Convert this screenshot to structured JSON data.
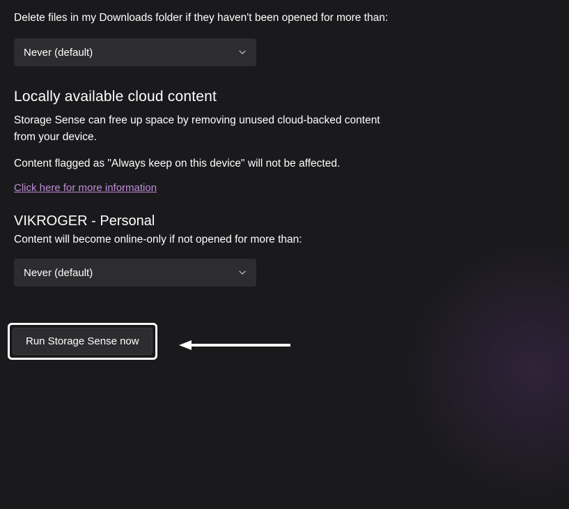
{
  "downloads": {
    "description": "Delete files in my Downloads folder if they haven't been opened for more than:",
    "dropdown_value": "Never (default)"
  },
  "cloud_section": {
    "heading": "Locally available cloud content",
    "line1": "Storage Sense can free up space by removing unused cloud-backed content from your device.",
    "line2": "Content flagged as \"Always keep on this device\" will not be affected.",
    "link_text": "Click here for more information"
  },
  "account_section": {
    "heading": "VIKROGER - Personal",
    "description": "Content will become online-only if not opened for more than:",
    "dropdown_value": "Never (default)"
  },
  "run_button": {
    "label": "Run Storage Sense now"
  }
}
